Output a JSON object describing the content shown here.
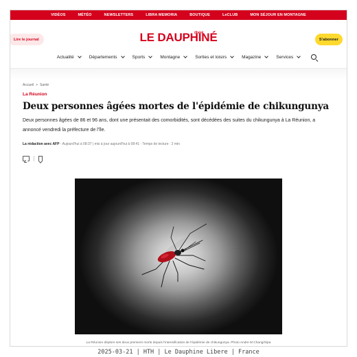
{
  "topbar": {
    "links": [
      "VIDÉOS",
      "MÉTÉO",
      "NEWSLETTERS",
      "LIBRA MEMORIA",
      "BOUTIQUE",
      "LeCLUB",
      "MON SÉJOUR EN MONTAGNE"
    ]
  },
  "header": {
    "read_label": "Lire le journal",
    "logo": "LE DAUPHINÉ",
    "logo_sub": "libéré",
    "subscribe_label": "S'abonner"
  },
  "nav": {
    "items": [
      "Actualité",
      "Départements",
      "Sports",
      "Montagne",
      "Sorties et loisirs",
      "Magazine",
      "Services"
    ]
  },
  "breadcrumb": {
    "home": "Accueil",
    "sep": ">",
    "section": "Santé"
  },
  "article": {
    "category": "La Réunion",
    "title": "Deux personnes âgées mortes de l'épidémie de chikungunya",
    "lede": "Deux personnes âgées de 86 et 96 ans, dont une présentait des comorbidités, sont décédées des suites du chikungunya à La Réunion, a annoncé vendredi la préfecture de l'île.",
    "author": "La rédaction avec AFP",
    "meta": " - Aujourd'hui à 08:37 | mis à jour aujourd'hui à 08:41 - Temps de lecture : 2 min",
    "caption": "La Réunion déplore ses deux premiers morts depuis l'intensification de l'épidémie de chikungunya. Photo Andre M Chang/Sipa"
  },
  "colors": {
    "brand_red": "#d4021d",
    "subscribe_yellow": "#ffd92e"
  },
  "footer": {
    "text": "2025-03-21 | HTH | Le Dauphine Libere | France"
  }
}
